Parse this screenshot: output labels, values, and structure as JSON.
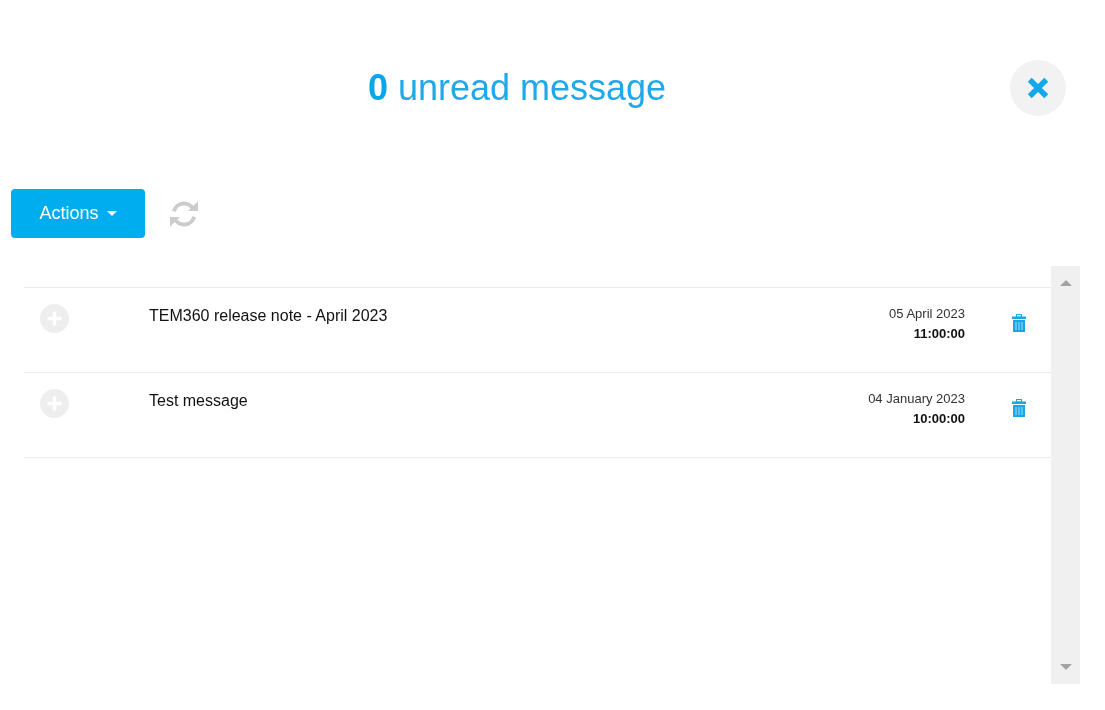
{
  "header": {
    "title": "**0** unread message"
  },
  "toolbar": {
    "actions_button": {
      "label": "Actions"
    }
  },
  "messages": [
    {
      "subject": "TEM360 release note - April 2023",
      "date": "05 April 2023",
      "time": "11:00:00"
    },
    {
      "subject": "Test message",
      "date": "04 January 2023",
      "time": "10:00:00"
    }
  ]
}
